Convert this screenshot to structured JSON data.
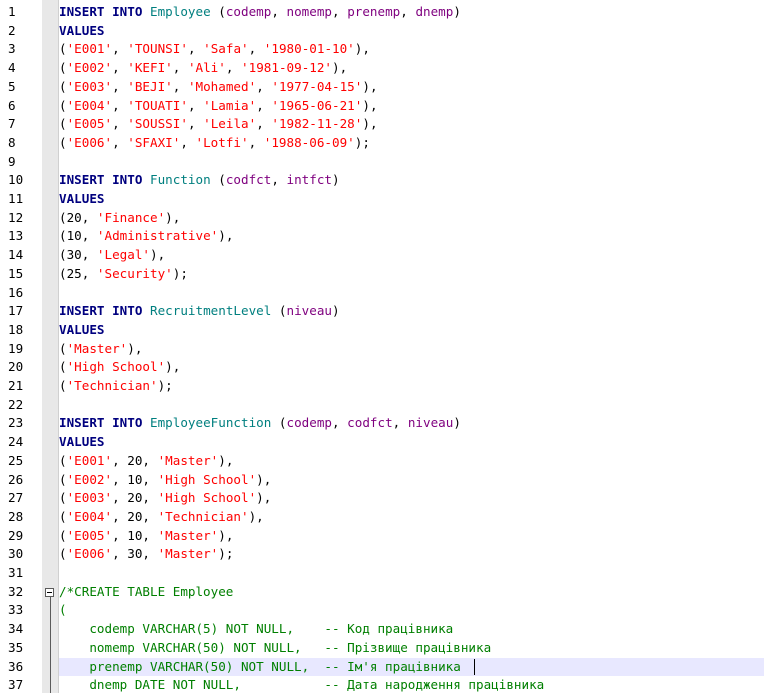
{
  "lines": [
    {
      "n": "1",
      "t": [
        [
          "kw",
          "INSERT INTO "
        ],
        [
          "id",
          "Employee"
        ],
        [
          "pl",
          " ("
        ],
        [
          "col",
          "codemp"
        ],
        [
          "pl",
          ", "
        ],
        [
          "col",
          "nomemp"
        ],
        [
          "pl",
          ", "
        ],
        [
          "col",
          "prenemp"
        ],
        [
          "pl",
          ", "
        ],
        [
          "col",
          "dnemp"
        ],
        [
          "pl",
          ")"
        ]
      ]
    },
    {
      "n": "2",
      "t": [
        [
          "kw",
          "VALUES"
        ]
      ]
    },
    {
      "n": "3",
      "t": [
        [
          "pl",
          "("
        ],
        [
          "str",
          "'E001'"
        ],
        [
          "pl",
          ", "
        ],
        [
          "str",
          "'TOUNSI'"
        ],
        [
          "pl",
          ", "
        ],
        [
          "str",
          "'Safa'"
        ],
        [
          "pl",
          ", "
        ],
        [
          "str",
          "'1980-01-10'"
        ],
        [
          "pl",
          "),"
        ]
      ]
    },
    {
      "n": "4",
      "t": [
        [
          "pl",
          "("
        ],
        [
          "str",
          "'E002'"
        ],
        [
          "pl",
          ", "
        ],
        [
          "str",
          "'KEFI'"
        ],
        [
          "pl",
          ", "
        ],
        [
          "str",
          "'Ali'"
        ],
        [
          "pl",
          ", "
        ],
        [
          "str",
          "'1981-09-12'"
        ],
        [
          "pl",
          "),"
        ]
      ]
    },
    {
      "n": "5",
      "t": [
        [
          "pl",
          "("
        ],
        [
          "str",
          "'E003'"
        ],
        [
          "pl",
          ", "
        ],
        [
          "str",
          "'BEJI'"
        ],
        [
          "pl",
          ", "
        ],
        [
          "str",
          "'Mohamed'"
        ],
        [
          "pl",
          ", "
        ],
        [
          "str",
          "'1977-04-15'"
        ],
        [
          "pl",
          "),"
        ]
      ]
    },
    {
      "n": "6",
      "t": [
        [
          "pl",
          "("
        ],
        [
          "str",
          "'E004'"
        ],
        [
          "pl",
          ", "
        ],
        [
          "str",
          "'TOUATI'"
        ],
        [
          "pl",
          ", "
        ],
        [
          "str",
          "'Lamia'"
        ],
        [
          "pl",
          ", "
        ],
        [
          "str",
          "'1965-06-21'"
        ],
        [
          "pl",
          "),"
        ]
      ]
    },
    {
      "n": "7",
      "t": [
        [
          "pl",
          "("
        ],
        [
          "str",
          "'E005'"
        ],
        [
          "pl",
          ", "
        ],
        [
          "str",
          "'SOUSSI'"
        ],
        [
          "pl",
          ", "
        ],
        [
          "str",
          "'Leila'"
        ],
        [
          "pl",
          ", "
        ],
        [
          "str",
          "'1982-11-28'"
        ],
        [
          "pl",
          "),"
        ]
      ]
    },
    {
      "n": "8",
      "t": [
        [
          "pl",
          "("
        ],
        [
          "str",
          "'E006'"
        ],
        [
          "pl",
          ", "
        ],
        [
          "str",
          "'SFAXI'"
        ],
        [
          "pl",
          ", "
        ],
        [
          "str",
          "'Lotfi'"
        ],
        [
          "pl",
          ", "
        ],
        [
          "str",
          "'1988-06-09'"
        ],
        [
          "pl",
          ");"
        ]
      ]
    },
    {
      "n": "9",
      "t": []
    },
    {
      "n": "10",
      "t": [
        [
          "kw",
          "INSERT INTO "
        ],
        [
          "id",
          "Function"
        ],
        [
          "pl",
          " ("
        ],
        [
          "col",
          "codfct"
        ],
        [
          "pl",
          ", "
        ],
        [
          "col",
          "intfct"
        ],
        [
          "pl",
          ")"
        ]
      ]
    },
    {
      "n": "11",
      "t": [
        [
          "kw",
          "VALUES"
        ]
      ]
    },
    {
      "n": "12",
      "t": [
        [
          "pl",
          "(20, "
        ],
        [
          "str",
          "'Finance'"
        ],
        [
          "pl",
          "),"
        ]
      ]
    },
    {
      "n": "13",
      "t": [
        [
          "pl",
          "(10, "
        ],
        [
          "str",
          "'Administrative'"
        ],
        [
          "pl",
          "),"
        ]
      ]
    },
    {
      "n": "14",
      "t": [
        [
          "pl",
          "(30, "
        ],
        [
          "str",
          "'Legal'"
        ],
        [
          "pl",
          "),"
        ]
      ]
    },
    {
      "n": "15",
      "t": [
        [
          "pl",
          "(25, "
        ],
        [
          "str",
          "'Security'"
        ],
        [
          "pl",
          ");"
        ]
      ]
    },
    {
      "n": "16",
      "t": []
    },
    {
      "n": "17",
      "t": [
        [
          "kw",
          "INSERT INTO "
        ],
        [
          "id",
          "RecruitmentLevel"
        ],
        [
          "pl",
          " ("
        ],
        [
          "col",
          "niveau"
        ],
        [
          "pl",
          ")"
        ]
      ]
    },
    {
      "n": "18",
      "t": [
        [
          "kw",
          "VALUES"
        ]
      ]
    },
    {
      "n": "19",
      "t": [
        [
          "pl",
          "("
        ],
        [
          "str",
          "'Master'"
        ],
        [
          "pl",
          "),"
        ]
      ]
    },
    {
      "n": "20",
      "t": [
        [
          "pl",
          "("
        ],
        [
          "str",
          "'High School'"
        ],
        [
          "pl",
          "),"
        ]
      ]
    },
    {
      "n": "21",
      "t": [
        [
          "pl",
          "("
        ],
        [
          "str",
          "'Technician'"
        ],
        [
          "pl",
          ");"
        ]
      ]
    },
    {
      "n": "22",
      "t": []
    },
    {
      "n": "23",
      "t": [
        [
          "kw",
          "INSERT INTO "
        ],
        [
          "id",
          "EmployeeFunction"
        ],
        [
          "pl",
          " ("
        ],
        [
          "col",
          "codemp"
        ],
        [
          "pl",
          ", "
        ],
        [
          "col",
          "codfct"
        ],
        [
          "pl",
          ", "
        ],
        [
          "col",
          "niveau"
        ],
        [
          "pl",
          ")"
        ]
      ]
    },
    {
      "n": "24",
      "t": [
        [
          "kw",
          "VALUES"
        ]
      ]
    },
    {
      "n": "25",
      "t": [
        [
          "pl",
          "("
        ],
        [
          "str",
          "'E001'"
        ],
        [
          "pl",
          ", 20, "
        ],
        [
          "str",
          "'Master'"
        ],
        [
          "pl",
          "),"
        ]
      ]
    },
    {
      "n": "26",
      "t": [
        [
          "pl",
          "("
        ],
        [
          "str",
          "'E002'"
        ],
        [
          "pl",
          ", 10, "
        ],
        [
          "str",
          "'High School'"
        ],
        [
          "pl",
          "),"
        ]
      ]
    },
    {
      "n": "27",
      "t": [
        [
          "pl",
          "("
        ],
        [
          "str",
          "'E003'"
        ],
        [
          "pl",
          ", 20, "
        ],
        [
          "str",
          "'High School'"
        ],
        [
          "pl",
          "),"
        ]
      ]
    },
    {
      "n": "28",
      "t": [
        [
          "pl",
          "("
        ],
        [
          "str",
          "'E004'"
        ],
        [
          "pl",
          ", 20, "
        ],
        [
          "str",
          "'Technician'"
        ],
        [
          "pl",
          "),"
        ]
      ]
    },
    {
      "n": "29",
      "t": [
        [
          "pl",
          "("
        ],
        [
          "str",
          "'E005'"
        ],
        [
          "pl",
          ", 10, "
        ],
        [
          "str",
          "'Master'"
        ],
        [
          "pl",
          "),"
        ]
      ]
    },
    {
      "n": "30",
      "t": [
        [
          "pl",
          "("
        ],
        [
          "str",
          "'E006'"
        ],
        [
          "pl",
          ", 30, "
        ],
        [
          "str",
          "'Master'"
        ],
        [
          "pl",
          ");"
        ]
      ]
    },
    {
      "n": "31",
      "t": []
    },
    {
      "n": "32",
      "t": [
        [
          "cmt",
          "/*CREATE TABLE Employee"
        ]
      ]
    },
    {
      "n": "33",
      "t": [
        [
          "cmt",
          "("
        ]
      ]
    },
    {
      "n": "34",
      "t": [
        [
          "cmt",
          "    codemp VARCHAR(5) NOT NULL,    -- Код працівника"
        ]
      ]
    },
    {
      "n": "35",
      "t": [
        [
          "cmt",
          "    nomemp VARCHAR(50) NOT NULL,   -- Прізвище працівника"
        ]
      ]
    },
    {
      "n": "36",
      "t": [
        [
          "cmt",
          "    prenemp VARCHAR(50) NOT NULL,  -- Ім'я працівника"
        ]
      ]
    },
    {
      "n": "37",
      "t": [
        [
          "cmt",
          "    dnemp DATE NOT NULL,           -- Дата народження працівника"
        ]
      ]
    }
  ],
  "current_line": "36",
  "fold_start_line": "32",
  "colors": {
    "keyword": "#00007f",
    "identifier": "#007f7f",
    "string": "#ff0000",
    "comment": "#007f00",
    "column": "#7f007f",
    "current_line_bg": "#e8e8ff"
  }
}
